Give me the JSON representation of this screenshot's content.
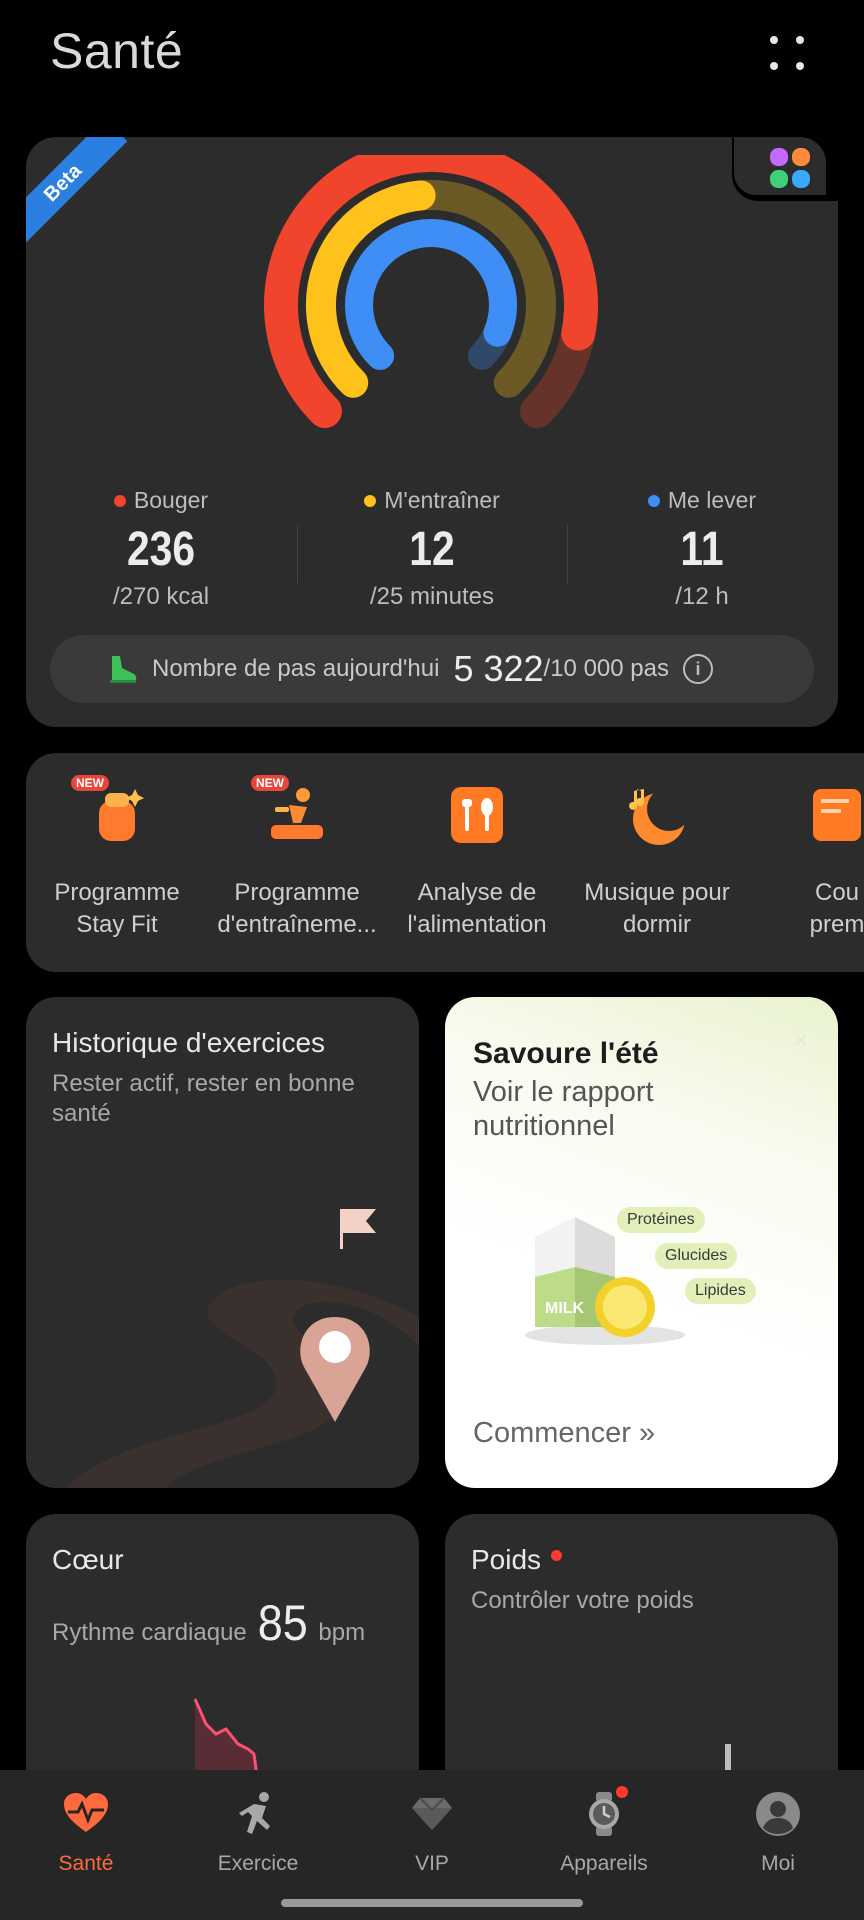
{
  "header": {
    "title": "Santé",
    "menu_icon": "more-grid-icon"
  },
  "activity": {
    "beta_label": "Beta",
    "apps_icon": "apps-grid-icon",
    "rings": {
      "move_progress": 0.874,
      "exercise_progress": 0.48,
      "stand_progress": 0.917
    },
    "colors": {
      "move": "#f0442c",
      "exercise": "#ffc21a",
      "stand": "#3f8ef5"
    },
    "stats": [
      {
        "label": "Bouger",
        "value": "236",
        "goal": "/270 kcal"
      },
      {
        "label": "M'entraîner",
        "value": "12",
        "goal": "/25 minutes"
      },
      {
        "label": "Me lever",
        "value": "11",
        "goal": "/12 h"
      }
    ],
    "steps": {
      "label": "Nombre de pas aujourd'hui",
      "value": "5 322",
      "goal": "/10 000 pas",
      "info": "i"
    }
  },
  "shortcuts": [
    {
      "label": "Programme\nStay Fit",
      "badge": "NEW",
      "icon": "stay-fit-icon"
    },
    {
      "label": "Programme\nd'entraîneme...",
      "badge": "NEW",
      "icon": "training-program-icon"
    },
    {
      "label": "Analyse de\nl'alimentation",
      "badge": "",
      "icon": "diet-analysis-icon"
    },
    {
      "label": "Musique pour\ndormir",
      "badge": "",
      "icon": "sleep-music-icon"
    },
    {
      "label": "Cou\nprem",
      "badge": "",
      "icon": "course-icon"
    }
  ],
  "history": {
    "title": "Historique d'exercices",
    "subtitle": "Rester actif, rester en bonne santé"
  },
  "nutrition": {
    "title": "Savoure l'été",
    "subtitle": "Voir le rapport nutritionnel",
    "tags": [
      "Protéines",
      "Glucides",
      "Lipides"
    ],
    "milk_label": "MILK",
    "cta": "Commencer",
    "cta_arrow": "»",
    "close": "×"
  },
  "heart": {
    "title": "Cœur",
    "label": "Rythme cardiaque",
    "value": "85",
    "unit": "bpm"
  },
  "weight": {
    "title": "Poids",
    "subtitle": "Contrôler votre poids"
  },
  "nav": [
    {
      "label": "Santé",
      "icon": "heart-pulse-icon",
      "active": true
    },
    {
      "label": "Exercice",
      "icon": "runner-icon",
      "active": false
    },
    {
      "label": "VIP",
      "icon": "diamond-icon",
      "active": false
    },
    {
      "label": "Appareils",
      "icon": "watch-icon",
      "active": false
    },
    {
      "label": "Moi",
      "icon": "profile-icon",
      "active": false
    }
  ]
}
